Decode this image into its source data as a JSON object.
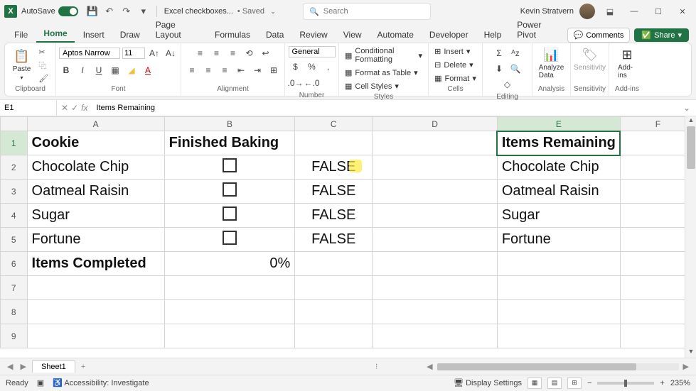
{
  "titlebar": {
    "autosave_label": "AutoSave",
    "autosave_state": "On",
    "filename": "Excel checkboxes...",
    "saved_status": "• Saved",
    "search_placeholder": "Search",
    "user_name": "Kevin Stratvern"
  },
  "tabs": {
    "file": "File",
    "home": "Home",
    "insert": "Insert",
    "draw": "Draw",
    "page_layout": "Page Layout",
    "formulas": "Formulas",
    "data": "Data",
    "review": "Review",
    "view": "View",
    "automate": "Automate",
    "developer": "Developer",
    "help": "Help",
    "power_pivot": "Power Pivot",
    "comments": "Comments",
    "share": "Share"
  },
  "ribbon": {
    "clipboard": {
      "label": "Clipboard",
      "paste": "Paste"
    },
    "font": {
      "label": "Font",
      "name": "Aptos Narrow",
      "size": "11"
    },
    "alignment": {
      "label": "Alignment"
    },
    "number": {
      "label": "Number",
      "format": "General"
    },
    "styles": {
      "label": "Styles",
      "cond": "Conditional Formatting",
      "table": "Format as Table",
      "cell": "Cell Styles"
    },
    "cells": {
      "label": "Cells",
      "insert": "Insert",
      "delete": "Delete",
      "format": "Format"
    },
    "editing": {
      "label": "Editing"
    },
    "analyze": {
      "label": "Analysis",
      "btn": "Analyze Data"
    },
    "sensitivity": {
      "label": "Sensitivity",
      "btn": "Sensitivity"
    },
    "addins": {
      "label": "Add-ins",
      "btn": "Add-ins"
    }
  },
  "namebox": {
    "ref": "E1",
    "formula": "Items Remaining"
  },
  "columns": [
    "A",
    "B",
    "C",
    "D",
    "E",
    "F"
  ],
  "rows": [
    "1",
    "2",
    "3",
    "4",
    "5",
    "6",
    "7",
    "8",
    "9"
  ],
  "data": {
    "A1": "Cookie",
    "B1": "Finished Baking",
    "E1": "Items Remaining",
    "A2": "Chocolate Chip",
    "C2": "FALSE",
    "E2": "Chocolate Chip",
    "A3": "Oatmeal Raisin",
    "C3": "FALSE",
    "E3": "Oatmeal Raisin",
    "A4": "Sugar",
    "C4": "FALSE",
    "E4": "Sugar",
    "A5": "Fortune",
    "C5": "FALSE",
    "E5": "Fortune",
    "A6": "Items Completed",
    "B6": "0%"
  },
  "sheet_tabs": {
    "sheet1": "Sheet1"
  },
  "status": {
    "ready": "Ready",
    "accessibility": "Accessibility: Investigate",
    "display_settings": "Display Settings",
    "zoom": "235%"
  }
}
